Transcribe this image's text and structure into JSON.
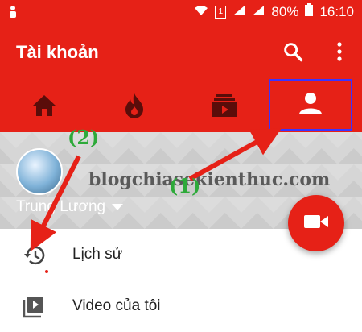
{
  "statusbar": {
    "battery": "80%",
    "time": "16:10",
    "sim": "1"
  },
  "appbar": {
    "title": "Tài khoản",
    "search_icon": "search-icon",
    "more_icon": "more-vert-icon"
  },
  "tabs": [
    {
      "icon": "home-icon"
    },
    {
      "icon": "trending-icon"
    },
    {
      "icon": "subscriptions-icon"
    },
    {
      "icon": "account-icon"
    }
  ],
  "profile": {
    "name": "Trung Lương"
  },
  "watermark": "blogchiasekienthuc.com",
  "annotations": {
    "one": "(1)",
    "two": "(2)"
  },
  "list": [
    {
      "icon": "history-icon",
      "label": "Lịch sử"
    },
    {
      "icon": "my-videos-icon",
      "label": "Video của tôi"
    }
  ],
  "colors": {
    "primary": "#e62117",
    "highlight": "#3a33ff",
    "annotation": "#2eaa3a"
  }
}
